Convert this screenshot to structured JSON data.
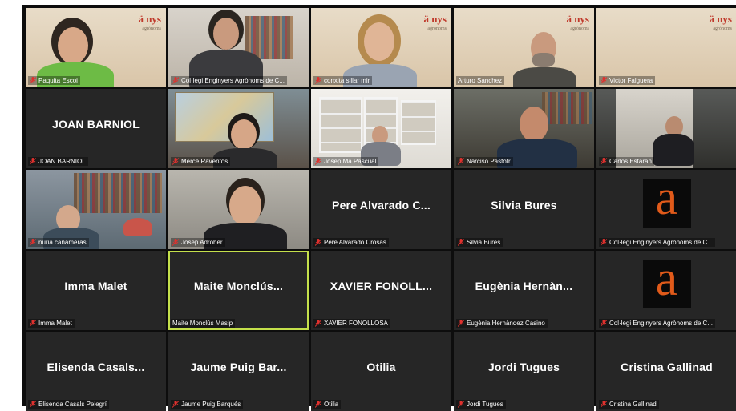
{
  "meeting": {
    "watermark": {
      "mark": "ä nys",
      "sub": "agrònoms"
    },
    "active_speaker_index": 16,
    "accent_color": "#c4e04b",
    "mic_muted_color": "#e0312e",
    "participants": [
      {
        "label": "Paquita Escoi",
        "big_name": "",
        "video": true,
        "muted": true
      },
      {
        "label": "Col·legi Enginyers Agrònoms de C...",
        "big_name": "",
        "video": true,
        "muted": true
      },
      {
        "label": "conxita sillar mir",
        "big_name": "",
        "video": true,
        "muted": true
      },
      {
        "label": "Arturo Sanchez",
        "big_name": "",
        "video": true,
        "muted": false
      },
      {
        "label": "Victor Falguera",
        "big_name": "",
        "video": true,
        "muted": true
      },
      {
        "label": "JOAN BARNIOL",
        "big_name": "JOAN BARNIOL",
        "video": false,
        "muted": true
      },
      {
        "label": "Mercè Raventós",
        "big_name": "",
        "video": true,
        "muted": true
      },
      {
        "label": "Josep Ma Pascual",
        "big_name": "",
        "video": true,
        "muted": true
      },
      {
        "label": "Narciso Pastotr",
        "big_name": "",
        "video": true,
        "muted": true
      },
      {
        "label": "Carlos Estarán",
        "big_name": "",
        "video": true,
        "muted": true
      },
      {
        "label": "nuria cañameras",
        "big_name": "",
        "video": true,
        "muted": true
      },
      {
        "label": "Josep Adroher",
        "big_name": "",
        "video": true,
        "muted": true
      },
      {
        "label": "Pere Alvarado Crosas",
        "big_name": "Pere Alvarado C...",
        "video": false,
        "muted": true
      },
      {
        "label": "Silvia Bures",
        "big_name": "Silvia Bures",
        "video": false,
        "muted": true
      },
      {
        "label": "Col·legi Enginyers Agrònoms de C...",
        "big_name": "",
        "video": false,
        "muted": true,
        "logo": "a"
      },
      {
        "label": "Imma Malet",
        "big_name": "Imma Malet",
        "video": false,
        "muted": true
      },
      {
        "label": "Maite Monclús Masip",
        "big_name": "Maite Monclús...",
        "video": false,
        "muted": false
      },
      {
        "label": "XAVIER FONOLLOSA",
        "big_name": "XAVIER FONOLL...",
        "video": false,
        "muted": true
      },
      {
        "label": "Eugènia Hernàndez Casino",
        "big_name": "Eugènia Hernàn...",
        "video": false,
        "muted": true
      },
      {
        "label": "Col·legi Enginyers Agrònoms de C...",
        "big_name": "",
        "video": false,
        "muted": true,
        "logo": "a"
      },
      {
        "label": "Elisenda Casals Pelegrí",
        "big_name": "Elisenda Casals...",
        "video": false,
        "muted": true
      },
      {
        "label": "Jaume Puig Barqués",
        "big_name": "Jaume Puig Bar...",
        "video": false,
        "muted": true
      },
      {
        "label": "Otilia",
        "big_name": "Otilia",
        "video": false,
        "muted": true
      },
      {
        "label": "Jordi Tugues",
        "big_name": "Jordi Tugues",
        "video": false,
        "muted": true
      },
      {
        "label": "Cristina Gallinad",
        "big_name": "Cristina Gallinad",
        "video": false,
        "muted": true
      }
    ]
  }
}
